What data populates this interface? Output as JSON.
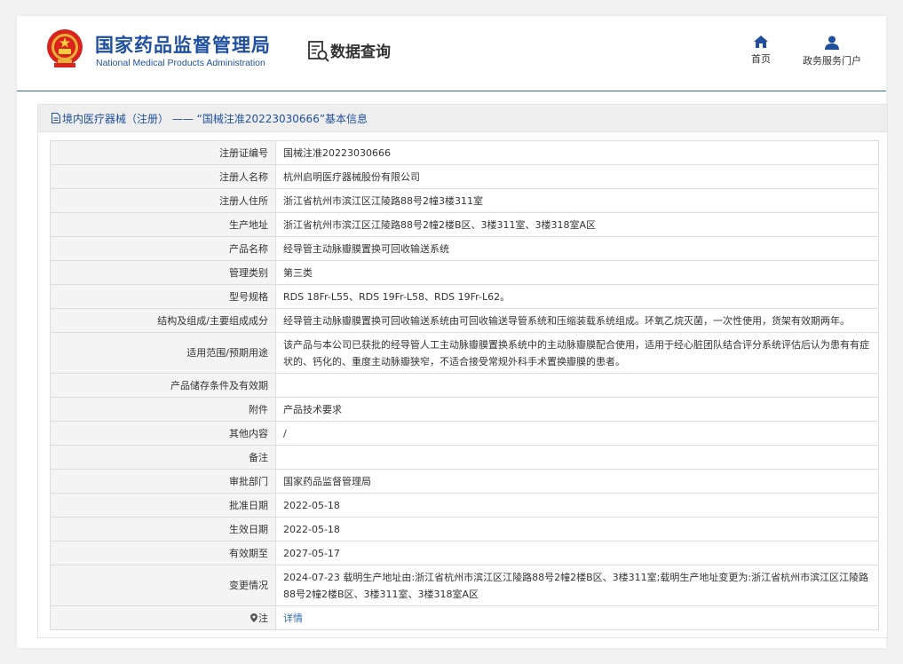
{
  "header": {
    "brand_cn": "国家药品监督管理局",
    "brand_en": "National Medical Products Administration",
    "query_title": "数据查询",
    "nav": [
      {
        "label": "首页",
        "icon": "home-icon"
      },
      {
        "label": "政务服务门户",
        "icon": "user-icon"
      }
    ]
  },
  "crumb": {
    "text": "境内医疗器械（注册） —— “国械注准20223030666”基本信息",
    "icon": "document-icon"
  },
  "colors": {
    "brand": "#1f4f9e",
    "link": "#2f6eb5",
    "label_bg": "#f4f4f4",
    "border": "#dcdcdc"
  },
  "rows": [
    {
      "label": "注册证编号",
      "value": "国械注准20223030666"
    },
    {
      "label": "注册人名称",
      "value": "杭州启明医疗器械股份有限公司"
    },
    {
      "label": "注册人住所",
      "value": "浙江省杭州市滨江区江陵路88号2幢3楼311室"
    },
    {
      "label": "生产地址",
      "value": "浙江省杭州市滨江区江陵路88号2幢2楼B区、3楼311室、3楼318室A区"
    },
    {
      "label": "产品名称",
      "value": "经导管主动脉瓣膜置换可回收输送系统"
    },
    {
      "label": "管理类别",
      "value": "第三类"
    },
    {
      "label": "型号规格",
      "value": "RDS 18Fr-L55、RDS 19Fr-L58、RDS 19Fr-L62。"
    },
    {
      "label": "结构及组成/主要组成成分",
      "value": "经导管主动脉瓣膜置换可回收输送系统由可回收输送导管系统和压缩装载系统组成。环氧乙烷灭菌，一次性使用，货架有效期两年。"
    },
    {
      "label": "适用范围/预期用途",
      "value": "该产品与本公司已获批的经导管人工主动脉瓣膜置换系统中的主动脉瓣膜配合使用，适用于经心脏团队结合评分系统评估后认为患有有症状的、钙化的、重度主动脉瓣狭窄，不适合接受常规外科手术置换瓣膜的患者。"
    },
    {
      "label": "产品储存条件及有效期",
      "value": ""
    },
    {
      "label": "附件",
      "value": "产品技术要求"
    },
    {
      "label": "其他内容",
      "value": "/"
    },
    {
      "label": "备注",
      "value": ""
    },
    {
      "label": "审批部门",
      "value": "国家药品监督管理局"
    },
    {
      "label": "批准日期",
      "value": "2022-05-18"
    },
    {
      "label": "生效日期",
      "value": "2022-05-18"
    },
    {
      "label": "有效期至",
      "value": "2027-05-17"
    },
    {
      "label": "变更情况",
      "value": "2024-07-23 载明生产地址由:浙江省杭州市滨江区江陵路88号2幢2楼B区、3楼311室;载明生产地址变更为:浙江省杭州市滨江区江陵路88号2幢2楼B区、3楼311室、3楼318室A区"
    },
    {
      "label": "注",
      "value": "详情"
    }
  ]
}
